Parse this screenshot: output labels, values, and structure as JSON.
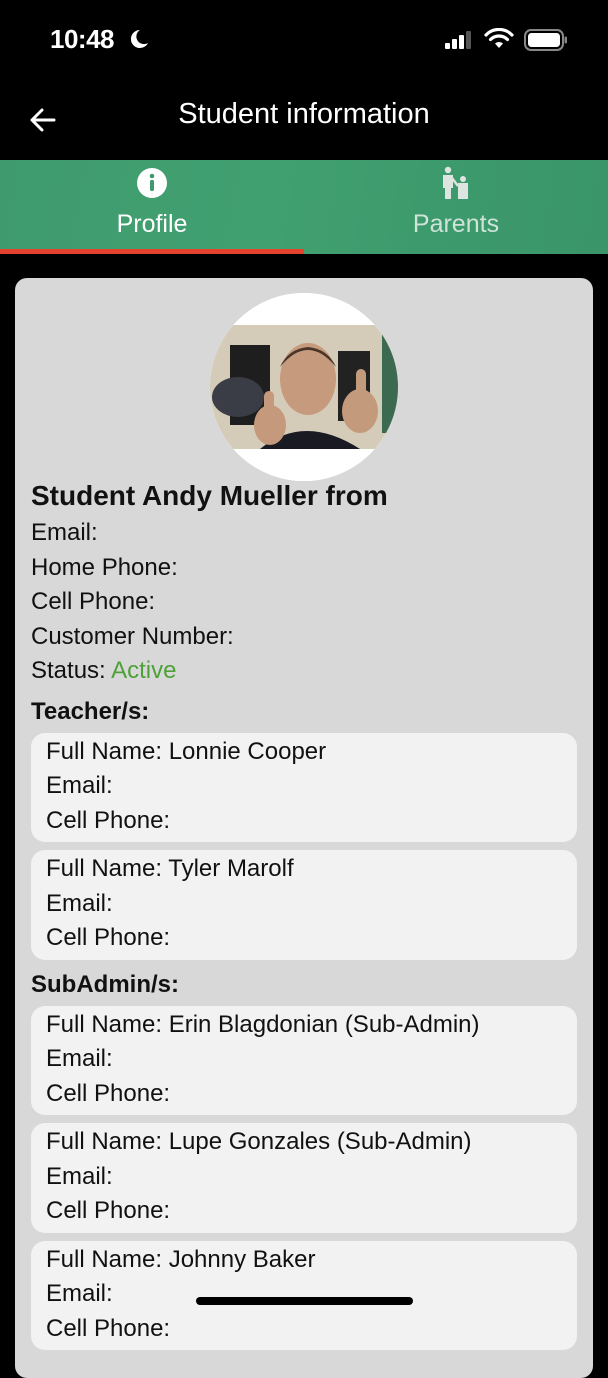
{
  "status_bar": {
    "time": "10:48",
    "icons": [
      "moon-icon",
      "signal-icon",
      "wifi-icon",
      "battery-icon"
    ]
  },
  "header": {
    "back_icon": "arrow-left-icon",
    "title": "Student information"
  },
  "tabs": [
    {
      "label": "Profile",
      "icon": "info-icon",
      "active": true
    },
    {
      "label": "Parents",
      "icon": "parent-child-icon",
      "active": false
    }
  ],
  "colors": {
    "tab_bar": "#3f9b6e",
    "tab_indicator": "#e4422f",
    "status_active": "#4ea138",
    "card_bg": "#d8d8d8",
    "contact_bg": "#f2f2f2"
  },
  "profile": {
    "avatar": "student-photo",
    "name_line": "Student Andy Mueller from",
    "email_label": "Email:",
    "home_phone_label": "Home Phone:",
    "cell_phone_label": "Cell Phone:",
    "customer_number_label": "Customer Number:",
    "status_label": "Status:",
    "status_value": "Active"
  },
  "teachers": {
    "heading": "Teacher/s:",
    "items": [
      {
        "full_name": "Full Name: Lonnie Cooper",
        "email": "Email:",
        "cell_phone": "Cell Phone:"
      },
      {
        "full_name": "Full Name: Tyler Marolf",
        "email": "Email:",
        "cell_phone": "Cell Phone:"
      }
    ]
  },
  "subadmins": {
    "heading": "SubAdmin/s:",
    "items": [
      {
        "full_name": "Full Name: Erin Blagdonian (Sub-Admin)",
        "email": "Email:",
        "cell_phone": "Cell Phone:"
      },
      {
        "full_name": "Full Name: Lupe Gonzales (Sub-Admin)",
        "email": "Email:",
        "cell_phone": "Cell Phone:"
      },
      {
        "full_name": "Full Name: Johnny Baker",
        "email": "Email:",
        "cell_phone": "Cell Phone:"
      }
    ]
  }
}
